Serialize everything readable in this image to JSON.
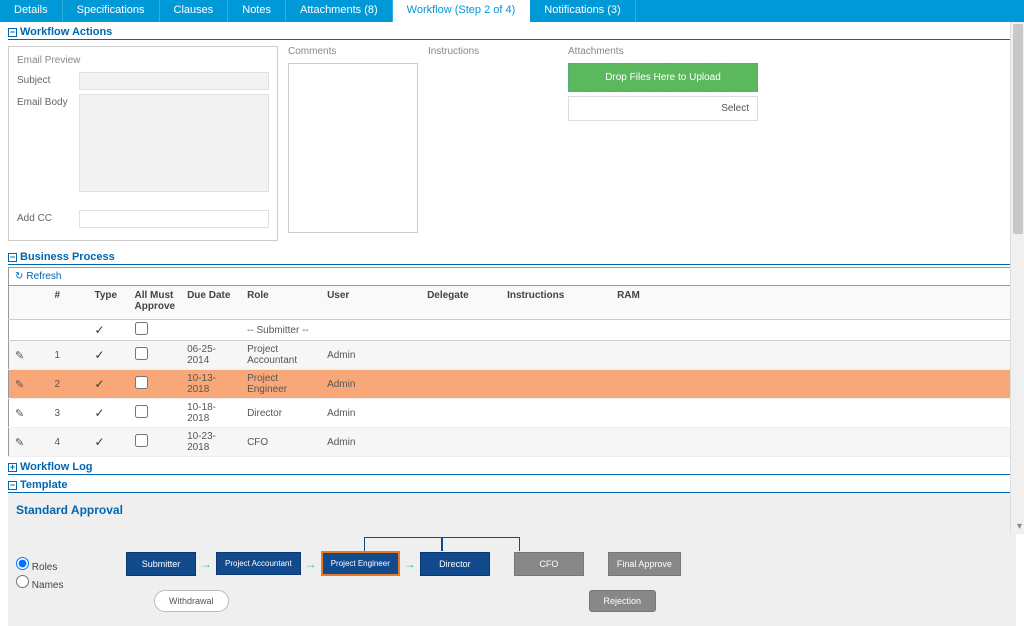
{
  "tabs": [
    {
      "label": "Details"
    },
    {
      "label": "Specifications"
    },
    {
      "label": "Clauses"
    },
    {
      "label": "Notes"
    },
    {
      "label": "Attachments (8)"
    },
    {
      "label": "Workflow (Step 2 of 4)"
    },
    {
      "label": "Notifications (3)"
    }
  ],
  "sections": {
    "workflow_actions": "Workflow Actions",
    "business_process": "Business Process",
    "workflow_log": "Workflow Log",
    "template": "Template"
  },
  "email": {
    "preview_label": "Email Preview",
    "subject_label": "Subject",
    "body_label": "Email Body",
    "addcc_label": "Add CC"
  },
  "comments_label": "Comments",
  "instructions_label": "Instructions",
  "attachments": {
    "label": "Attachments",
    "drop_text": "Drop Files Here to Upload",
    "select_text": "Select"
  },
  "refresh_label": "Refresh",
  "table": {
    "headers": {
      "num": "#",
      "type": "Type",
      "must": "All Must Approve",
      "due": "Due Date",
      "role": "Role",
      "user": "User",
      "delegate": "Delegate",
      "instructions": "Instructions",
      "ram": "RAM"
    },
    "filter_role": "-- Submitter --",
    "rows": [
      {
        "num": "1",
        "due": "06-25-2014",
        "role": "Project Accountant",
        "user": "Admin"
      },
      {
        "num": "2",
        "due": "10-13-2018",
        "role": "Project Engineer",
        "user": "Admin"
      },
      {
        "num": "3",
        "due": "10-18-2018",
        "role": "Director",
        "user": "Admin"
      },
      {
        "num": "4",
        "due": "10-23-2018",
        "role": "CFO",
        "user": "Admin"
      }
    ]
  },
  "template": {
    "title": "Standard Approval",
    "radio_roles": "Roles",
    "radio_names": "Names",
    "boxes": {
      "submitter": "Submitter",
      "pa": "Project Accountant",
      "pe": "Project Engineer",
      "director": "Director",
      "cfo": "CFO",
      "final": "Final Approve"
    },
    "withdrawal": "Withdrawal",
    "rejection": "Rejection"
  }
}
